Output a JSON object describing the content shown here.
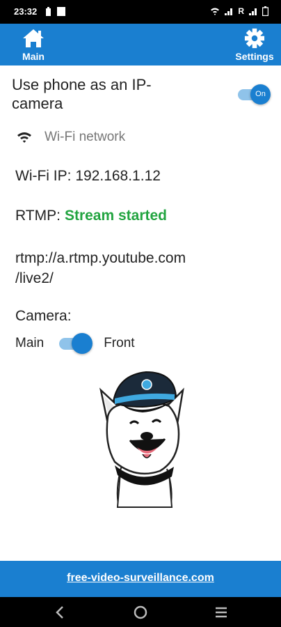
{
  "status_bar": {
    "time": "23:32"
  },
  "topbar": {
    "main_label": "Main",
    "settings_label": "Settings",
    "background": "#1a7fd0"
  },
  "main": {
    "use_phone_label": "Use phone as an IP-camera",
    "enable_toggle": {
      "label": "On",
      "state": "on"
    },
    "wifi_network_label": "Wi-Fi network",
    "wifi_ip": "Wi-Fi IP: 192.168.1.12",
    "rtmp_label": "RTMP:",
    "rtmp_status": "Stream started",
    "rtmp_status_color": "#22a440",
    "rtmp_url_line1": "rtmp://a.rtmp.youtube.com",
    "rtmp_url_line2": "/live2/",
    "camera_label": "Camera:",
    "camera_option_main": "Main",
    "camera_option_front": "Front",
    "camera_toggle_state": "front",
    "mascot_icon": "dog-mascot-in-captain-hat"
  },
  "footer": {
    "link_text": "free-video-surveillance.com"
  },
  "navbar": {
    "icons": [
      "back-icon",
      "home-circle-icon",
      "recents-icon"
    ]
  }
}
